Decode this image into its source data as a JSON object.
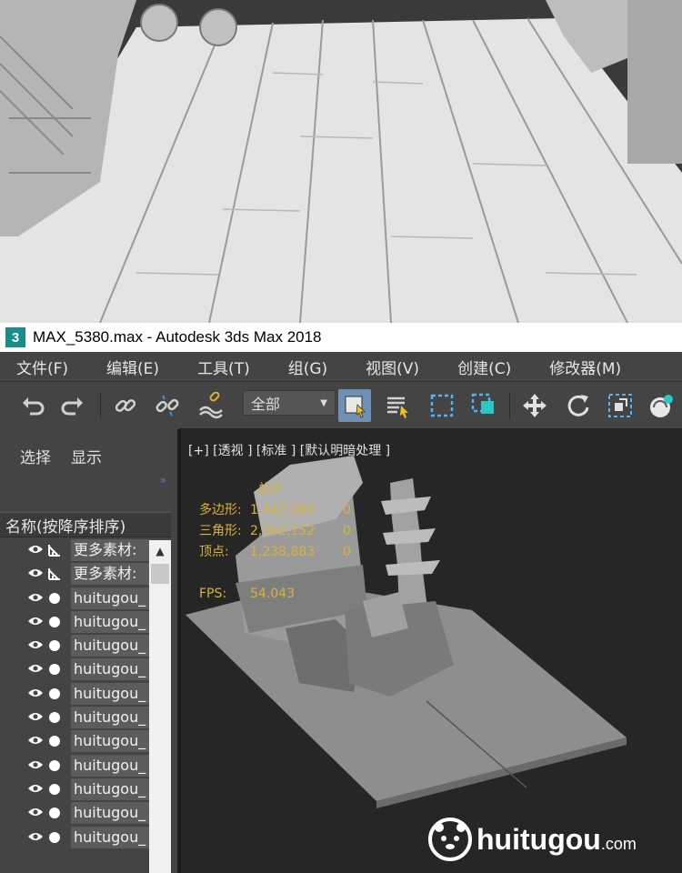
{
  "window": {
    "title": "MAX_5380.max - Autodesk 3ds Max 2018",
    "app_icon_text": "3"
  },
  "menu": [
    {
      "label": "文件(F)"
    },
    {
      "label": "编辑(E)"
    },
    {
      "label": "工具(T)"
    },
    {
      "label": "组(G)"
    },
    {
      "label": "视图(V)"
    },
    {
      "label": "创建(C)"
    },
    {
      "label": "修改器(M)"
    }
  ],
  "toolbar": {
    "selection_set": "全部",
    "icons": [
      "undo-icon",
      "redo-icon",
      "link-icon",
      "unlink-icon",
      "bind-space-warp-icon",
      "select-object-icon",
      "select-by-name-icon",
      "rectangular-selection-icon",
      "window-crossing-icon",
      "move-icon",
      "rotate-icon",
      "scale-icon",
      "placement-icon"
    ]
  },
  "scene_explorer": {
    "tabs": [
      "选择",
      "显示"
    ],
    "column_header": "名称(按降序排序)",
    "rows": [
      {
        "label": "更多素材:",
        "type": "bone"
      },
      {
        "label": "更多素材:",
        "type": "bone"
      },
      {
        "label": "huitugou_",
        "type": "geometry"
      },
      {
        "label": "huitugou_",
        "type": "geometry"
      },
      {
        "label": "huitugou_",
        "type": "geometry"
      },
      {
        "label": "huitugou_",
        "type": "geometry"
      },
      {
        "label": "huitugou_",
        "type": "geometry"
      },
      {
        "label": "huitugou_",
        "type": "geometry"
      },
      {
        "label": "huitugou_",
        "type": "geometry"
      },
      {
        "label": "huitugou_",
        "type": "geometry"
      },
      {
        "label": "huitugou_",
        "type": "geometry"
      },
      {
        "label": "huitugou_",
        "type": "geometry"
      },
      {
        "label": "huitugou_",
        "type": "geometry"
      }
    ]
  },
  "viewport": {
    "label": "[+] [透视 ] [标准 ] [默认明暗处理 ]",
    "stats": {
      "header": "总计",
      "rows": [
        {
          "name": "多边形:",
          "value": "1,442,280",
          "selected": "0"
        },
        {
          "name": "三角形:",
          "value": "2,362,152",
          "selected": "0"
        },
        {
          "name": "顶点:",
          "value": "1,238,883",
          "selected": "0"
        }
      ],
      "fps_label": "FPS:",
      "fps_value": "54.043"
    }
  },
  "watermark": {
    "brand": "huitugou",
    "suffix": ".com"
  },
  "colors": {
    "panel": "#444444",
    "viewport": "#262626",
    "stats_text": "#d9b23a",
    "accent": "#4a90d9"
  }
}
